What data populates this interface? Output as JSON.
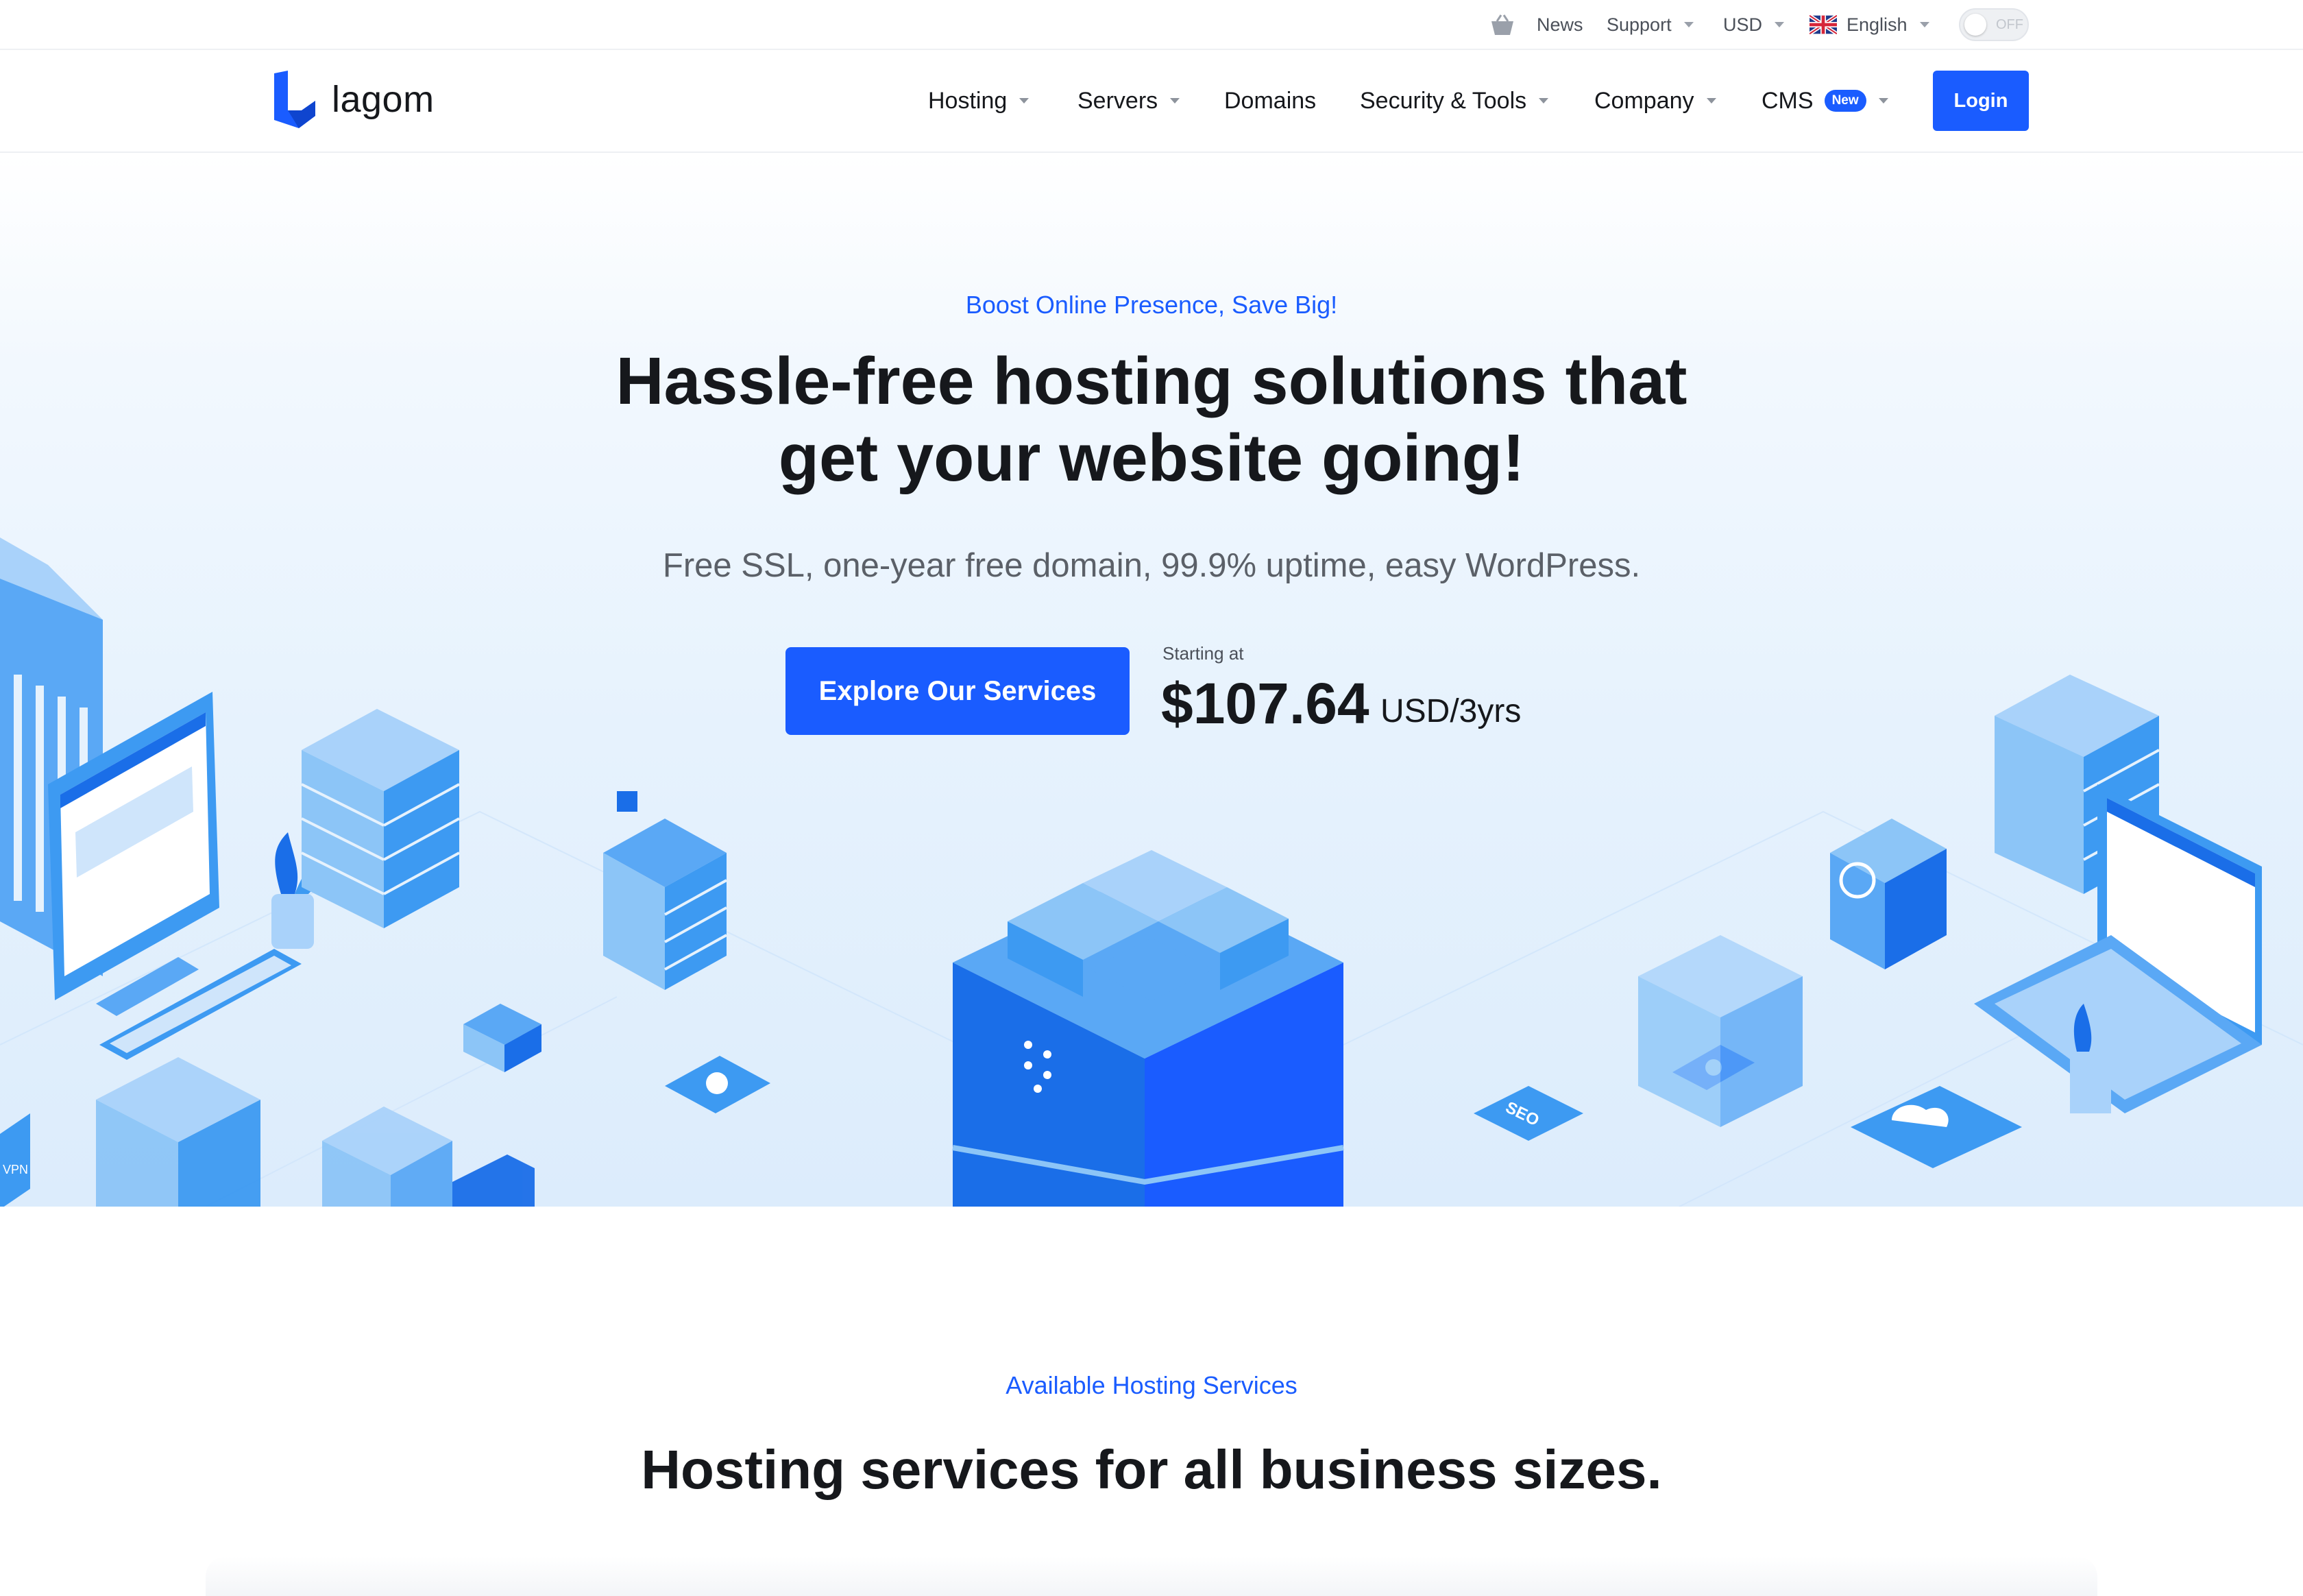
{
  "topbar": {
    "news": "News",
    "support": "Support",
    "currency": "USD",
    "language": "English",
    "theme_toggle": "OFF",
    "icons": [
      "basket-icon",
      "uk-flag-icon",
      "sun-icon"
    ]
  },
  "nav": {
    "logo_text": "lagom",
    "items": [
      "Hosting",
      "Servers",
      "Domains",
      "Security & Tools",
      "Company",
      "CMS"
    ],
    "cms_badge": "New",
    "login": "Login"
  },
  "hero": {
    "eyebrow": "Boost Online Presence, Save Big!",
    "title_line1": "Hassle-free hosting solutions that",
    "title_line2": "get your website going!",
    "subtitle": "Free SSL, one-year free domain, 99.9% uptime, easy WordPress.",
    "cta": "Explore Our Services",
    "starting_at": "Starting at",
    "price": "$107.64",
    "period": "USD/3yrs",
    "illustration_labels": [
      "VPN",
      "SEO"
    ]
  },
  "services": {
    "eyebrow": "Available Hosting Services",
    "title": "Hosting services for all business sizes."
  },
  "colors": {
    "accent": "#1a5cff",
    "text": "#16181c",
    "illustration_light": "#8cc5f7",
    "illustration_mid": "#3d9af2",
    "illustration_dark": "#1a6ee8"
  }
}
